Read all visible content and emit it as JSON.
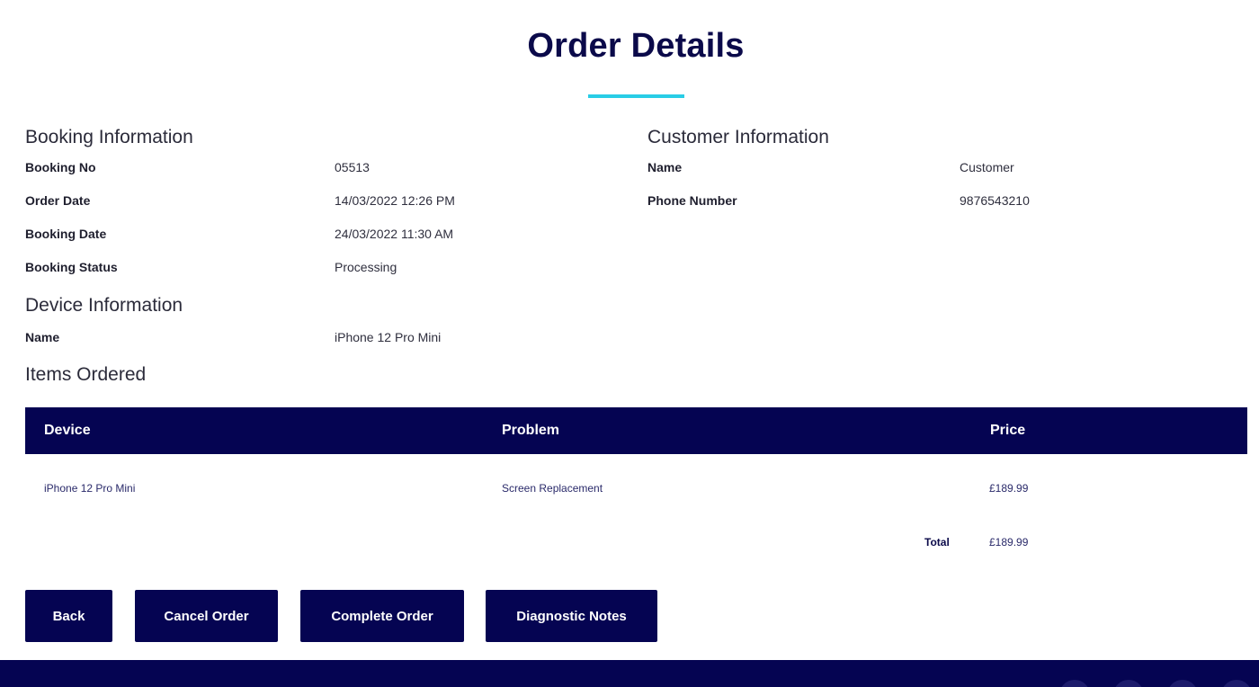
{
  "page": {
    "title": "Order Details"
  },
  "booking": {
    "heading": "Booking Information",
    "booking_no_label": "Booking No",
    "booking_no": "05513",
    "order_date_label": "Order Date",
    "order_date": "14/03/2022 12:26 PM",
    "booking_date_label": "Booking Date",
    "booking_date": "24/03/2022 11:30 AM",
    "status_label": "Booking Status",
    "status": "Processing"
  },
  "customer": {
    "heading": "Customer Information",
    "name_label": "Name",
    "name": "Customer",
    "phone_label": "Phone Number",
    "phone": "9876543210"
  },
  "device": {
    "heading": "Device Information",
    "name_label": "Name",
    "name": "iPhone 12 Pro Mini"
  },
  "items": {
    "heading": "Items Ordered",
    "columns": [
      "Device",
      "Problem",
      "Price"
    ],
    "rows": [
      {
        "device": "iPhone 12 Pro Mini",
        "problem": "Screen Replacement",
        "price": "£189.99"
      }
    ],
    "total_label": "Total",
    "total": "£189.99"
  },
  "actions": {
    "back": "Back",
    "cancel": "Cancel Order",
    "complete": "Complete Order",
    "notes": "Diagnostic Notes"
  },
  "colors": {
    "primary": "#050452",
    "accent": "#29cde6"
  }
}
